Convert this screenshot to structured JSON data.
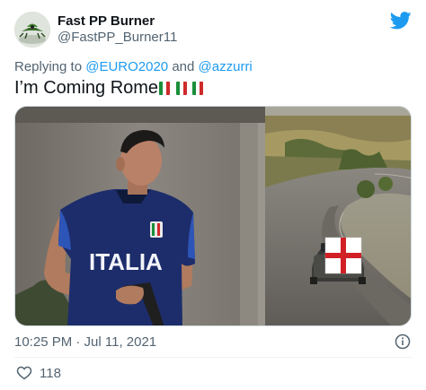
{
  "author": {
    "display_name": "Fast PP Burner",
    "handle": "@FastPP_Burner11",
    "avatar_icon": "avatar-image"
  },
  "platform_icon": "twitter-bird-icon",
  "brand_color": "#1d9bf0",
  "reply": {
    "prefix": "Replying to",
    "mention_1": "@EURO2020",
    "conjunction": "and",
    "mention_2": "@azzurri"
  },
  "tweet": {
    "text": "I’m Coming Rome",
    "flags": [
      "italy-flag",
      "italy-flag",
      "italy-flag"
    ]
  },
  "media": {
    "description_icon": "meme-image",
    "shirt_text": "ITALIA"
  },
  "timestamp": "10:25 PM · Jul 11, 2021",
  "likes": {
    "count": "118"
  }
}
